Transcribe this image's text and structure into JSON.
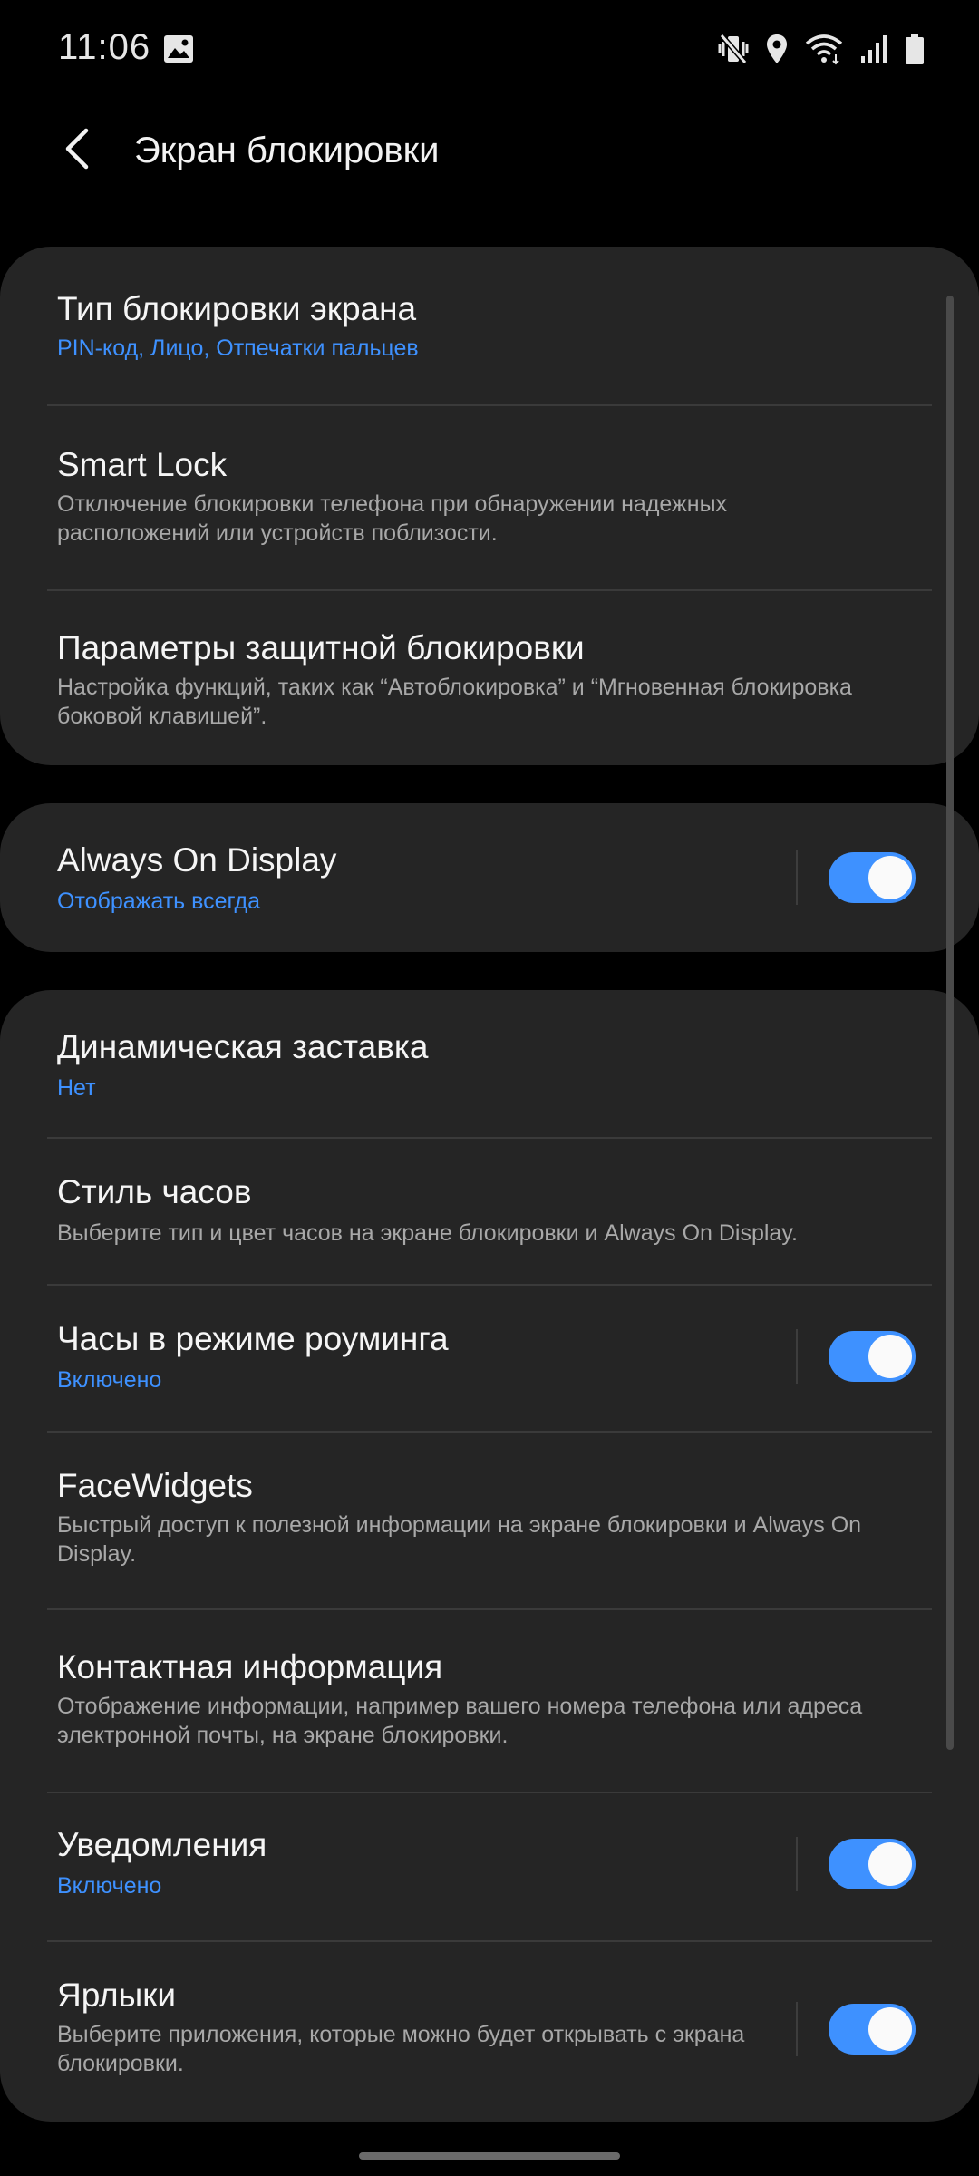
{
  "status": {
    "time": "11:06",
    "icons": [
      "image-icon",
      "mute-vibrate-icon",
      "location-icon",
      "wifi-icon",
      "signal-icon",
      "battery-icon"
    ]
  },
  "header": {
    "back_icon": "back-arrow-icon",
    "title": "Экран блокировки"
  },
  "colors": {
    "accent": "#3e91ff",
    "card_bg": "#252525",
    "background": "#000000"
  },
  "groups": [
    {
      "items": [
        {
          "title": "Тип блокировки экрана",
          "subtitle": "PIN-код, Лицо, Отпечатки пальцев",
          "subtitle_accent": true
        },
        {
          "title": "Smart Lock",
          "subtitle": "Отключение блокировки телефона при обнаружении надежных расположений или устройств поблизости."
        },
        {
          "title": "Параметры защитной блокировки",
          "subtitle": "Настройка функций, таких как “Автоблокировка” и “Мгновенная блокировка боковой клавишей”."
        }
      ]
    },
    {
      "items": [
        {
          "title": "Always On Display",
          "subtitle": "Отображать всегда",
          "subtitle_accent": true,
          "toggle": true
        }
      ]
    },
    {
      "items": [
        {
          "title": "Динамическая заставка",
          "subtitle": "Нет",
          "subtitle_accent": true
        },
        {
          "title": "Стиль часов",
          "subtitle": "Выберите тип и цвет часов на экране блокировки и Always On Display."
        },
        {
          "title": "Часы в режиме роуминга",
          "subtitle": "Включено",
          "subtitle_accent": true,
          "toggle": true
        },
        {
          "title": "FaceWidgets",
          "subtitle": "Быстрый доступ к полезной информации на экране блокировки и Always On Display."
        },
        {
          "title": "Контактная информация",
          "subtitle": "Отображение информации, например вашего номера телефона или адреса электронной почты, на экране блокировки."
        },
        {
          "title": "Уведомления",
          "subtitle": "Включено",
          "subtitle_accent": true,
          "toggle": true
        },
        {
          "title": "Ярлыки",
          "subtitle": "Выберите приложения, которые можно будет открывать с экрана блокировки.",
          "toggle": true
        }
      ]
    }
  ]
}
